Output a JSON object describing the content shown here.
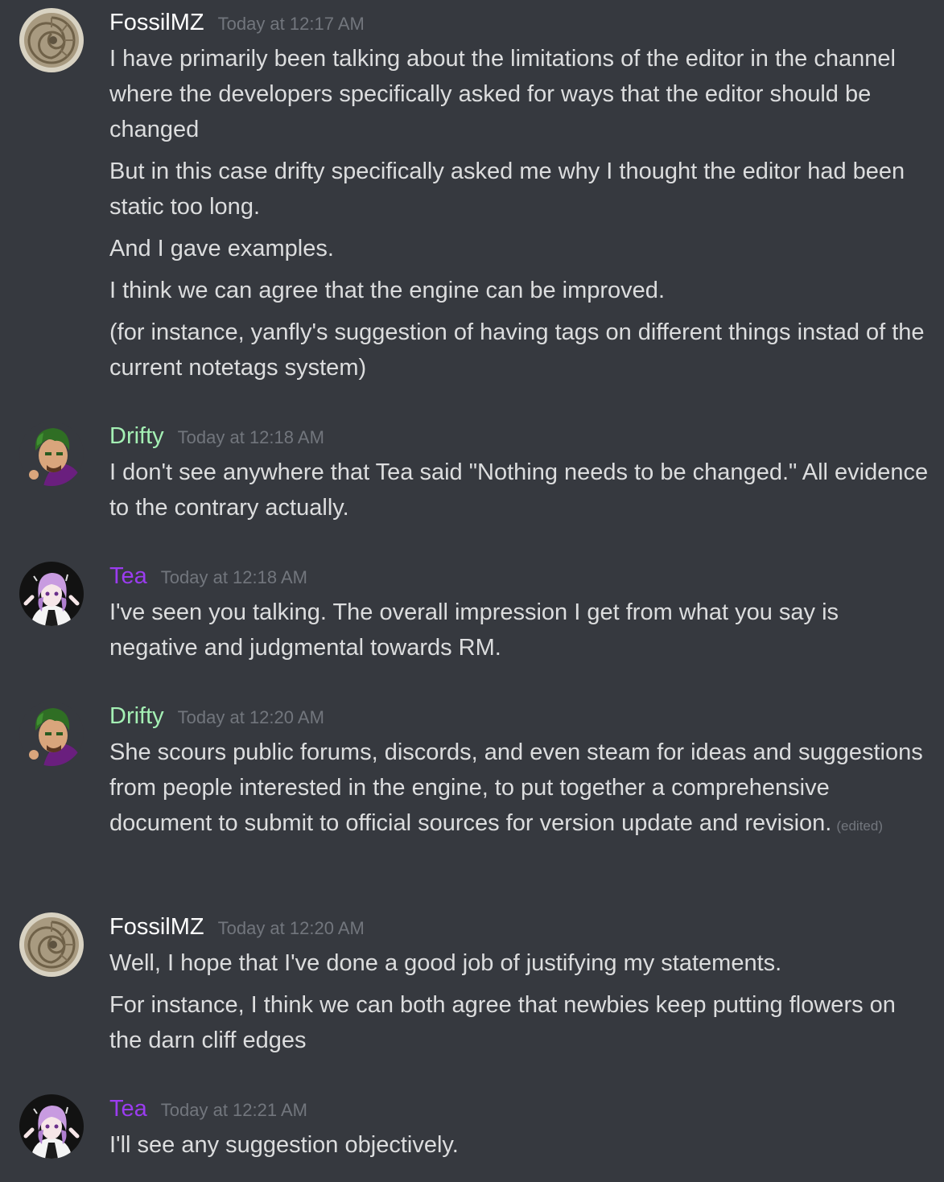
{
  "colors": {
    "background": "#36393f",
    "text": "#dcddde",
    "timestamp": "#72767d",
    "fossil_name": "#ffffff",
    "drifty_name": "#a4f0b4",
    "tea_name": "#9b3cf0"
  },
  "groups": [
    {
      "author": "FossilMZ",
      "avatar_icon": "ammonite-fossil-avatar",
      "timestamp": "Today at 12:17 AM",
      "messages": [
        "I have primarily been talking about the limitations of the editor in the channel where the developers specifically asked for ways that the editor should be changed",
        "But in this case drifty specifically asked me why I thought the editor had been static too long.",
        "And I gave examples.",
        "I think we can agree that the engine can be improved.",
        "(for instance, yanfly's suggestion of having tags on different things instad of the current notetags system)"
      ]
    },
    {
      "author": "Drifty",
      "avatar_icon": "drifty-avatar",
      "timestamp": "Today at 12:18 AM",
      "messages": [
        "I don't see anywhere that Tea said \"Nothing needs to be changed.\" All evidence to the contrary actually."
      ]
    },
    {
      "author": "Tea",
      "avatar_icon": "tea-avatar",
      "timestamp": "Today at 12:18 AM",
      "messages": [
        "I've seen you talking. The overall impression I get from what you say is negative and judgmental towards RM."
      ]
    },
    {
      "author": "Drifty",
      "avatar_icon": "drifty-avatar",
      "timestamp": "Today at 12:20 AM",
      "messages": [
        "She scours public forums, discords, and even steam for ideas and suggestions from people interested in the engine, to put together a comprehensive document to submit to official sources for version update and revision."
      ],
      "edited_label": "(edited)"
    },
    {
      "author": "FossilMZ",
      "avatar_icon": "ammonite-fossil-avatar",
      "timestamp": "Today at 12:20 AM",
      "messages": [
        "Well, I hope that I've done a good job of justifying my statements.",
        "For instance, I think we can both agree that newbies keep putting flowers on the darn cliff edges"
      ]
    },
    {
      "author": "Tea",
      "avatar_icon": "tea-avatar",
      "timestamp": "Today at 12:21 AM",
      "messages": [
        "I'll see any suggestion objectively."
      ]
    }
  ]
}
